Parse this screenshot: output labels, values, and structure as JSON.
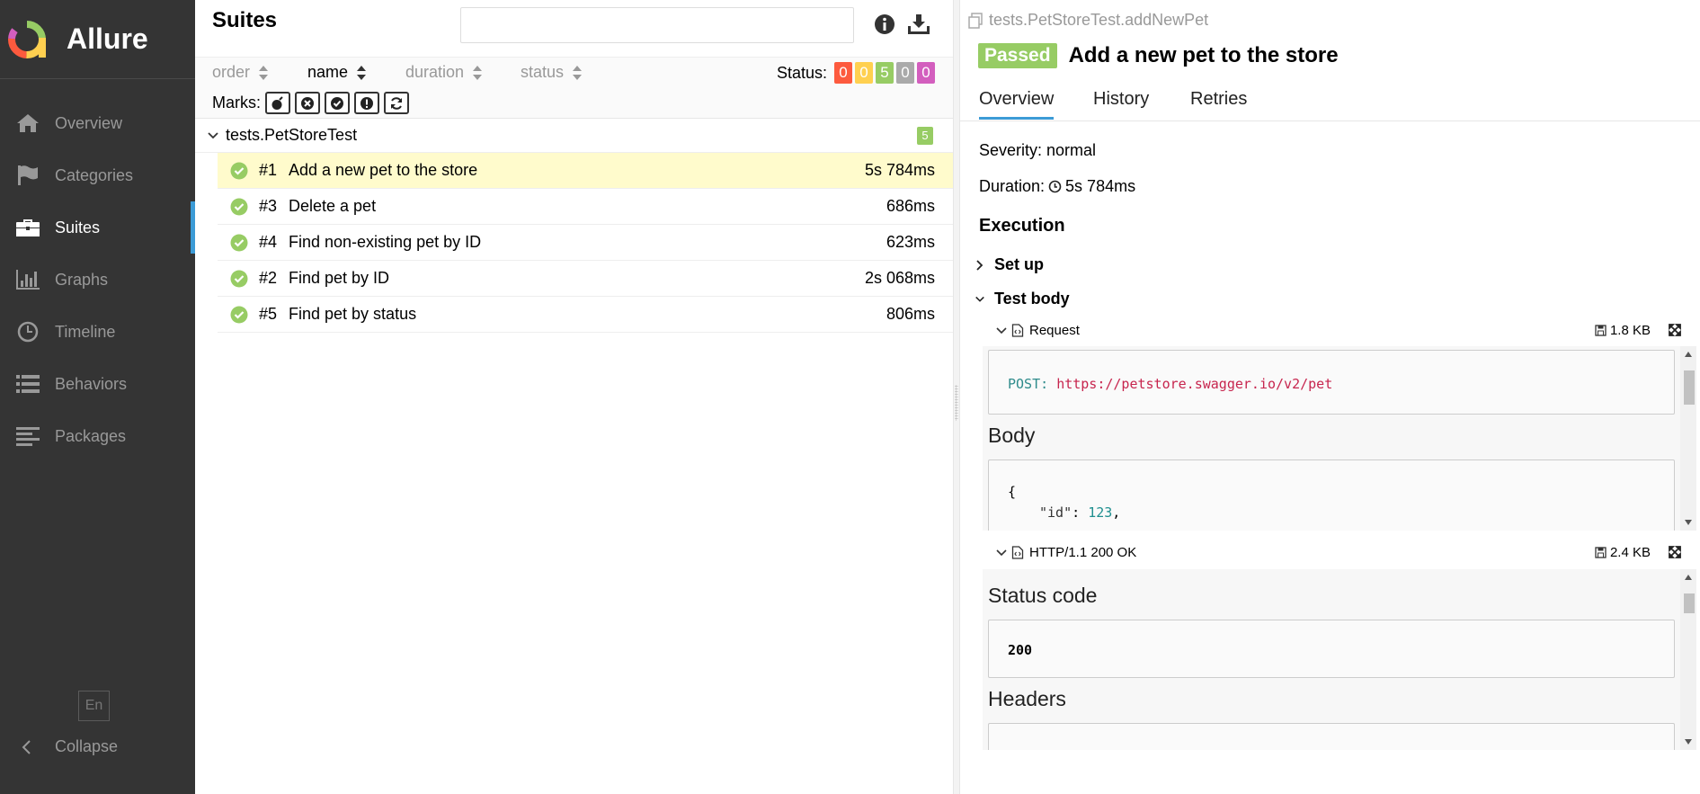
{
  "sidebar": {
    "brand": "Allure",
    "items": [
      {
        "id": "overview",
        "label": "Overview",
        "icon": "home-icon"
      },
      {
        "id": "categories",
        "label": "Categories",
        "icon": "flag-icon"
      },
      {
        "id": "suites",
        "label": "Suites",
        "icon": "briefcase-icon",
        "active": true
      },
      {
        "id": "graphs",
        "label": "Graphs",
        "icon": "bar-chart-icon"
      },
      {
        "id": "timeline",
        "label": "Timeline",
        "icon": "clock-icon"
      },
      {
        "id": "behaviors",
        "label": "Behaviors",
        "icon": "list-icon"
      },
      {
        "id": "packages",
        "label": "Packages",
        "icon": "align-left-icon"
      }
    ],
    "lang": "En",
    "collapse": "Collapse"
  },
  "suites": {
    "title": "Suites",
    "search_placeholder": "",
    "sort": {
      "order": "order",
      "name": "name",
      "duration": "duration",
      "status": "status"
    },
    "status_label": "Status:",
    "status_counts": [
      {
        "name": "failed",
        "count": "0",
        "color": "#fd5a3e"
      },
      {
        "name": "broken",
        "count": "0",
        "color": "#ffd050"
      },
      {
        "name": "passed",
        "count": "5",
        "color": "#97cc64"
      },
      {
        "name": "skipped",
        "count": "0",
        "color": "#aaaaaa"
      },
      {
        "name": "unknown",
        "count": "0",
        "color": "#d35ebe"
      }
    ],
    "marks_label": "Marks:",
    "group": {
      "name": "tests.PetStoreTest",
      "count": "5"
    },
    "tests": [
      {
        "num": "#1",
        "name": "Add a new pet to the store",
        "duration": "5s 784ms",
        "selected": true
      },
      {
        "num": "#3",
        "name": "Delete a pet",
        "duration": "686ms"
      },
      {
        "num": "#4",
        "name": "Find non-existing pet by ID",
        "duration": "623ms"
      },
      {
        "num": "#2",
        "name": "Find pet by ID",
        "duration": "2s 068ms"
      },
      {
        "num": "#5",
        "name": "Find pet by status",
        "duration": "806ms"
      }
    ]
  },
  "details": {
    "fullname": "tests.PetStoreTest.addNewPet",
    "status": "Passed",
    "title": "Add a new pet to the store",
    "tabs": [
      "Overview",
      "History",
      "Retries"
    ],
    "severity": "Severity: normal",
    "duration_label": "Duration:",
    "duration": "5s 784ms",
    "execution": "Execution",
    "setup": "Set up",
    "test_body": "Test body",
    "request": {
      "name": "Request",
      "size": "1.8 KB",
      "method": "POST",
      "url": "https://petstore.swagger.io/v2/pet",
      "body_heading": "Body",
      "body_line1": "{",
      "body_key": "\"id\"",
      "body_val": "123"
    },
    "response": {
      "name": "HTTP/1.1 200 OK",
      "size": "2.4 KB",
      "status_heading": "Status code",
      "status_code": "200",
      "headers_heading": "Headers"
    }
  },
  "colors": {
    "sidebar_bg": "#343434",
    "accent": "#3c9bd6",
    "passed": "#97cc64",
    "selected_row": "#fffbcc"
  }
}
